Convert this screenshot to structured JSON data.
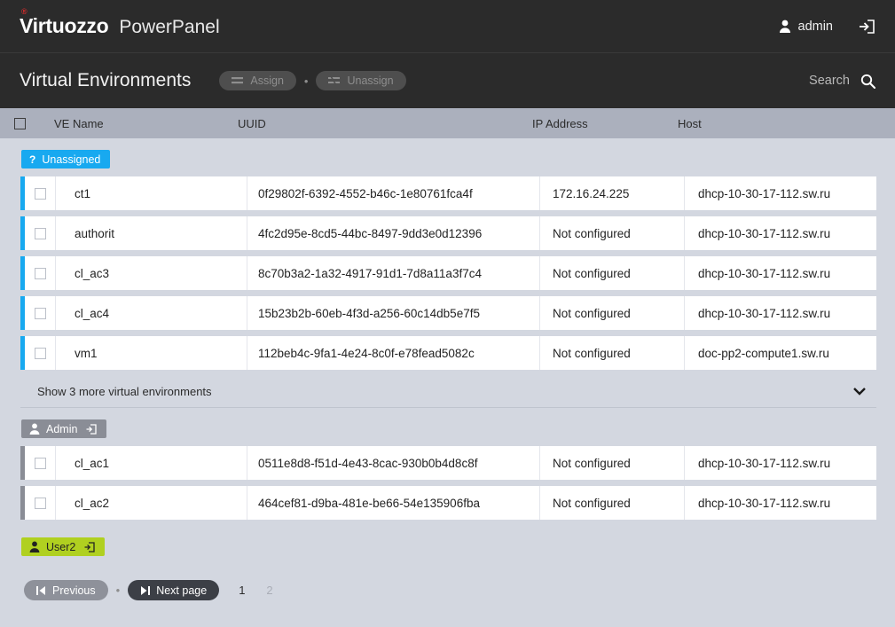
{
  "header": {
    "brand": "Virtuozzo",
    "brand_tm": "®",
    "product": "PowerPanel",
    "user": "admin",
    "user_icon": "person-icon",
    "logout_icon": "logout-icon"
  },
  "subheader": {
    "title": "Virtual Environments",
    "assign_label": "Assign",
    "assign_icon": "assign-lines-icon",
    "unassign_label": "Unassign",
    "unassign_icon": "unassign-lines-icon",
    "separator": "•",
    "search_label": "Search",
    "search_placeholder": "Search",
    "search_value": "",
    "search_icon": "search-icon"
  },
  "table": {
    "columns": [
      "VE Name",
      "UUID",
      "IP Address",
      "Host"
    ],
    "select_all_checked": false
  },
  "groups": [
    {
      "badge": "Unassigned",
      "badge_style": "unassigned",
      "badge_icon": "question-mark-icon",
      "stripe_color": "#18a9f0",
      "rows": [
        {
          "name": "ct1",
          "uuid": "0f29802f-6392-4552-b46c-1e80761fca4f",
          "ip": "172.16.24.225",
          "host": "dhcp-10-30-17-112.sw.ru",
          "checked": false
        },
        {
          "name": "authorit",
          "uuid": "4fc2d95e-8cd5-44bc-8497-9dd3e0d12396",
          "ip": "Not configured",
          "host": "dhcp-10-30-17-112.sw.ru",
          "checked": false
        },
        {
          "name": "cl_ac3",
          "uuid": "8c70b3a2-1a32-4917-91d1-7d8a11a3f7c4",
          "ip": "Not configured",
          "host": "dhcp-10-30-17-112.sw.ru",
          "checked": false
        },
        {
          "name": "cl_ac4",
          "uuid": "15b23b2b-60eb-4f3d-a256-60c14db5e7f5",
          "ip": "Not configured",
          "host": "dhcp-10-30-17-112.sw.ru",
          "checked": false
        },
        {
          "name": "vm1",
          "uuid": "112beb4c-9fa1-4e24-8c0f-e78fead5082c",
          "ip": "Not configured",
          "host": "doc-pp2-compute1.sw.ru",
          "checked": false
        }
      ],
      "show_more": "Show 3 more virtual environments",
      "show_more_icon": "chevron-down-icon"
    },
    {
      "badge": "Admin",
      "badge_style": "admin",
      "badge_icon": "person-icon",
      "badge_extra_icon": "login-arrow-icon",
      "stripe_color": "#8a8d96",
      "rows": [
        {
          "name": "cl_ac1",
          "uuid": "0511e8d8-f51d-4e43-8cac-930b0b4d8c8f",
          "ip": "Not configured",
          "host": "dhcp-10-30-17-112.sw.ru",
          "checked": false
        },
        {
          "name": "cl_ac2",
          "uuid": "464cef81-d9ba-481e-be66-54e135906fba",
          "ip": "Not configured",
          "host": "dhcp-10-30-17-112.sw.ru",
          "checked": false
        }
      ],
      "show_more": null
    },
    {
      "badge": "User2",
      "badge_style": "user2",
      "badge_icon": "person-icon",
      "badge_extra_icon": "login-arrow-icon",
      "stripe_color": "#b0d020",
      "rows": [],
      "show_more": null
    }
  ],
  "pagination": {
    "previous_label": "Previous",
    "previous_icon": "first-page-icon",
    "next_label": "Next page",
    "next_icon": "next-page-icon",
    "separator": "•",
    "pages": [
      "1",
      "2"
    ],
    "active_page": "1"
  },
  "colors": {
    "accent_blue": "#18a9f0",
    "badge_admin": "#8a8d96",
    "badge_user2": "#b0d020",
    "topbar": "#2b2b2b",
    "table_header": "#abb0bd",
    "page_bg": "#d3d7e0"
  }
}
